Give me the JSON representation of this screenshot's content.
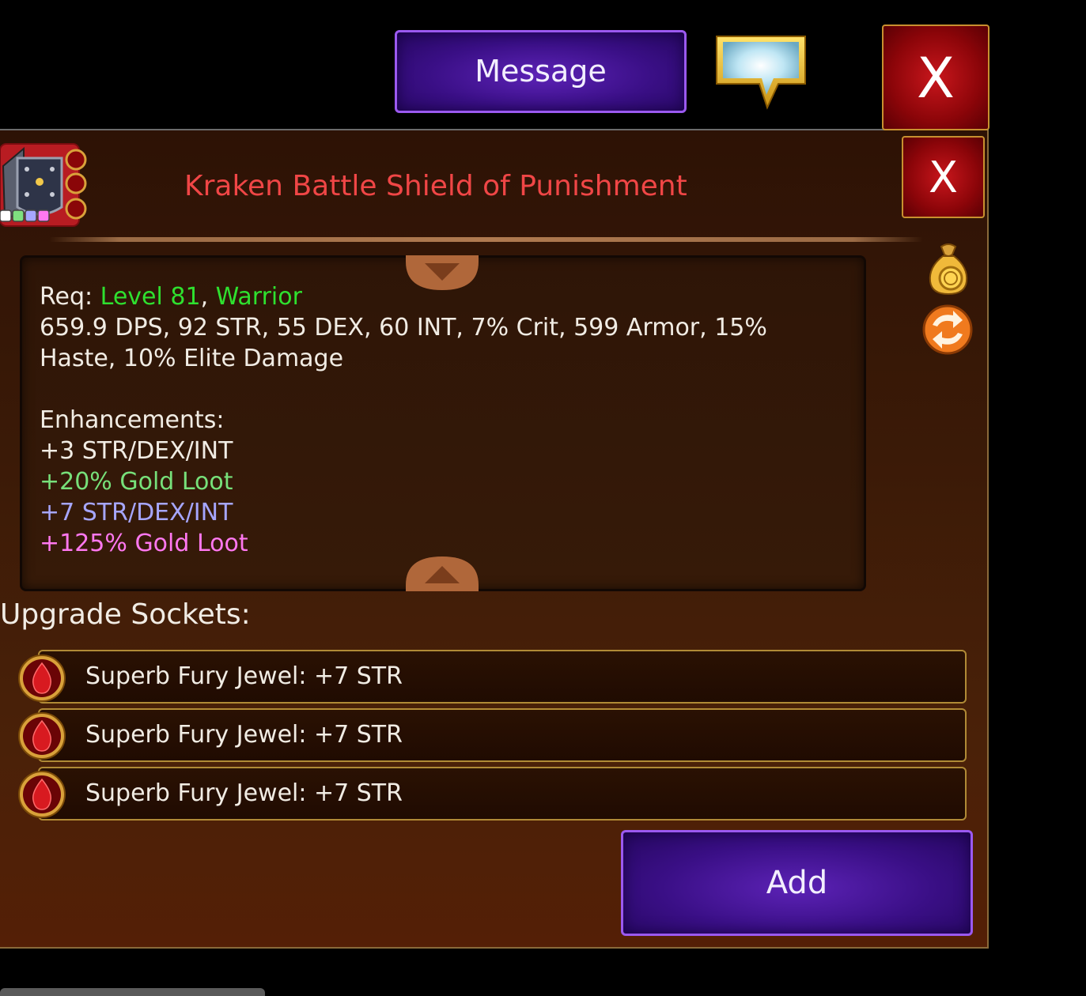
{
  "header": {
    "message_label": "Message",
    "close_label": "X"
  },
  "item": {
    "title": "Kraken Battle Shield of Punishment",
    "close_label": "X",
    "req_label": "Req:",
    "req_level": "Level 81",
    "req_sep": ",",
    "req_class": "Warrior",
    "stats_line1": "659.9 DPS, 92 STR, 55 DEX, 60 INT, 7% Crit, 599 Armor, 15%",
    "stats_line2": "Haste, 10% Elite Damage",
    "enhancements_heading": "Enhancements:",
    "enhancements": [
      "+3 STR/DEX/INT",
      "+20% Gold Loot",
      "+7 STR/DEX/INT",
      "+125% Gold Loot"
    ]
  },
  "sockets": {
    "heading": "Upgrade Sockets:",
    "items": [
      "Superb Fury Jewel: +7 STR",
      "Superb Fury Jewel: +7 STR",
      "Superb Fury Jewel: +7 STR"
    ]
  },
  "actions": {
    "add_label": "Add"
  },
  "colors": {
    "title": "#f04646",
    "requirement": "#2fe02f",
    "enh_common": "#f1ece4",
    "enh_uncommon": "#77e07a",
    "enh_rare": "#a6a6ff",
    "enh_epic": "#ff78f0",
    "button_purple": "#3a0f86",
    "close_red": "#8c0509"
  },
  "icons": [
    "chat-bubble-icon",
    "item-shield-icon",
    "gold-bag-icon",
    "swap-icon",
    "scroll-up-arrow-icon",
    "scroll-down-arrow-icon",
    "red-gem-icon"
  ]
}
